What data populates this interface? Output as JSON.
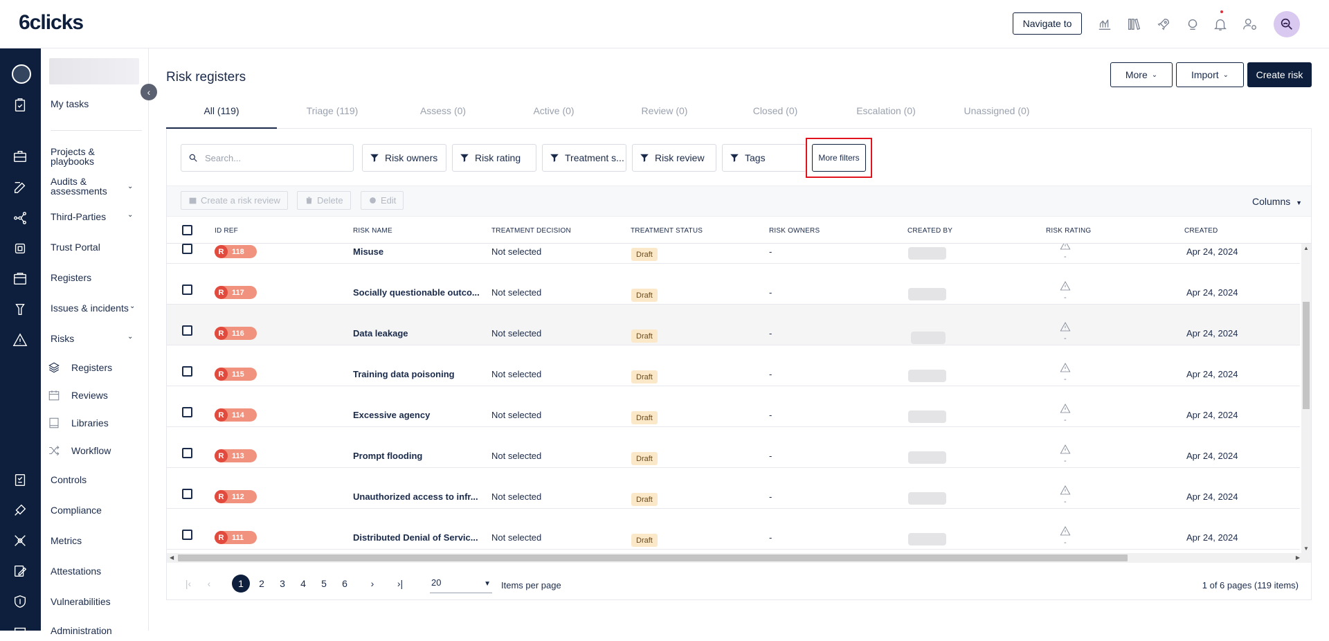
{
  "app": {
    "logo": "6clicks"
  },
  "topbar": {
    "navigate_label": "Navigate to"
  },
  "sidebar": {
    "my_tasks": "My tasks",
    "projects": "Projects & playbooks",
    "audits": "Audits & assessments",
    "third_parties": "Third-Parties",
    "trust_portal": "Trust Portal",
    "registers": "Registers",
    "issues": "Issues & incidents",
    "risks": "Risks",
    "risks_sub": [
      "Registers",
      "Reviews",
      "Libraries",
      "Workflow"
    ],
    "controls": "Controls",
    "compliance": "Compliance",
    "metrics": "Metrics",
    "attestations": "Attestations",
    "vulnerabilities": "Vulnerabilities",
    "administration": "Administration"
  },
  "page": {
    "title": "Risk registers"
  },
  "header_buttons": {
    "more": "More",
    "import": "Import",
    "create": "Create risk"
  },
  "tabs": [
    "All (119)",
    "Triage (119)",
    "Assess (0)",
    "Active (0)",
    "Review (0)",
    "Closed (0)",
    "Escalation (0)",
    "Unassigned (0)"
  ],
  "search": {
    "placeholder": "Search..."
  },
  "filters": [
    "Risk owners",
    "Risk rating",
    "Treatment s...",
    "Risk review",
    "Tags"
  ],
  "more_filters": "More filters",
  "actions": {
    "create_review": "Create a risk review",
    "delete": "Delete",
    "edit": "Edit",
    "columns": "Columns"
  },
  "table": {
    "headers": [
      "ID REF",
      "RISK NAME",
      "TREATMENT DECISION",
      "TREATMENT STATUS",
      "RISK OWNERS",
      "CREATED BY",
      "RISK RATING",
      "CREATED"
    ],
    "rows": [
      {
        "id": "118",
        "name": "Misuse",
        "decision": "Not selected",
        "status": "Draft",
        "owners": "-",
        "rating": "-",
        "created": "Apr 24, 2024"
      },
      {
        "id": "117",
        "name": "Socially questionable outco...",
        "decision": "Not selected",
        "status": "Draft",
        "owners": "-",
        "rating": "-",
        "created": "Apr 24, 2024"
      },
      {
        "id": "116",
        "name": "Data leakage",
        "decision": "Not selected",
        "status": "Draft",
        "owners": "-",
        "rating": "-",
        "created": "Apr 24, 2024"
      },
      {
        "id": "115",
        "name": "Training data poisoning",
        "decision": "Not selected",
        "status": "Draft",
        "owners": "-",
        "rating": "-",
        "created": "Apr 24, 2024"
      },
      {
        "id": "114",
        "name": "Excessive agency",
        "decision": "Not selected",
        "status": "Draft",
        "owners": "-",
        "rating": "-",
        "created": "Apr 24, 2024"
      },
      {
        "id": "113",
        "name": "Prompt flooding",
        "decision": "Not selected",
        "status": "Draft",
        "owners": "-",
        "rating": "-",
        "created": "Apr 24, 2024"
      },
      {
        "id": "112",
        "name": "Unauthorized access to infr...",
        "decision": "Not selected",
        "status": "Draft",
        "owners": "-",
        "rating": "-",
        "created": "Apr 24, 2024"
      },
      {
        "id": "111",
        "name": "Distributed Denial of Servic...",
        "decision": "Not selected",
        "status": "Draft",
        "owners": "-",
        "rating": "-",
        "created": "Apr 24, 2024"
      }
    ],
    "id_prefix": "R"
  },
  "pagination": {
    "pages": [
      "1",
      "2",
      "3",
      "4",
      "5",
      "6"
    ],
    "current": "1",
    "per_page": "20",
    "per_page_label": "Items per page",
    "info": "1 of 6 pages (119 items)"
  },
  "colors": {
    "brand": "#0d1f3c",
    "highlight": "#e0141e",
    "badge": "#e14a3c",
    "draft": "#fbe8c9"
  }
}
